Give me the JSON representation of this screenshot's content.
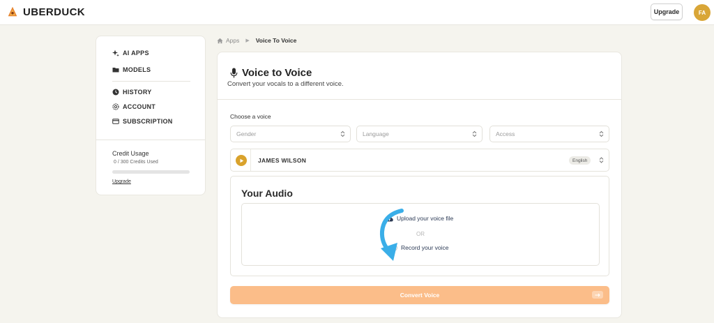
{
  "header": {
    "brand": "UBERDUCK",
    "upgrade_label": "Upgrade",
    "avatar_initials": "FA"
  },
  "sidebar": {
    "items": [
      {
        "label": "AI APPS",
        "icon": "sparkle-icon"
      },
      {
        "label": "MODELS",
        "icon": "folder-icon"
      },
      {
        "label": "HISTORY",
        "icon": "clock-icon"
      },
      {
        "label": "ACCOUNT",
        "icon": "gear-icon"
      },
      {
        "label": "SUBSCRIPTION",
        "icon": "card-icon"
      }
    ],
    "credit_title": "Credit Usage",
    "credit_text": "0 / 300 Credits Used",
    "credit_used_fraction": 0,
    "upgrade_link": "Upgrade"
  },
  "breadcrumb": {
    "root": "Apps",
    "current": "Voice To Voice"
  },
  "main": {
    "title": "Voice to Voice",
    "subtitle": "Convert your vocals to a different voice.",
    "choose_label": "Choose a voice",
    "selects": {
      "gender": "Gender",
      "language": "Language",
      "access": "Access"
    },
    "voice": {
      "name": "JAMES WILSON",
      "language_badge": "English"
    },
    "audio": {
      "title": "Your Audio",
      "upload_label": "Upload your voice file",
      "or_label": "OR",
      "record_label": "Record your voice"
    },
    "convert_label": "Convert Voice"
  },
  "colors": {
    "accent_orange": "#fbbd89",
    "play_gold": "#d9a22c",
    "avatar_gold": "#d9a637",
    "annotation_blue": "#3aaee8",
    "record_red": "#d63a3a"
  }
}
